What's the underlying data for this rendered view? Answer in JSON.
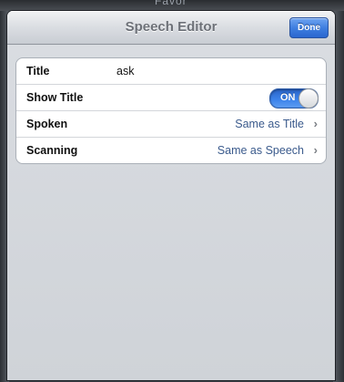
{
  "background": {
    "partial_title": "Favor"
  },
  "navbar": {
    "title": "Speech Editor",
    "done_label": "Done"
  },
  "rows": [
    {
      "label": "Title",
      "value": "ask"
    },
    {
      "label": "Show Title",
      "toggle": {
        "state_label": "ON",
        "on": true
      }
    },
    {
      "label": "Spoken",
      "value": "Same as Title"
    },
    {
      "label": "Scanning",
      "value": "Same as Speech"
    }
  ],
  "icons": {
    "disclosure": "chevron-right-icon"
  },
  "colors": {
    "accent": "#3b82ea",
    "value_text": "#3a5a8c"
  }
}
